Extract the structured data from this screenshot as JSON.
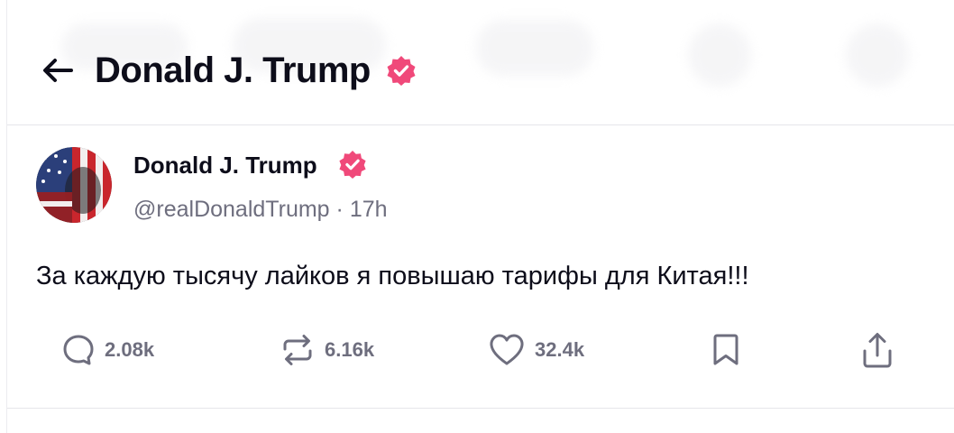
{
  "header": {
    "back_label": "back",
    "title": "Donald J. Trump",
    "verified": true
  },
  "post": {
    "author_name": "Donald J. Trump",
    "handle": "@realDonaldTrump",
    "separator": "·",
    "time": "17h",
    "text": "За каждую тысячу лайков я повышаю тарифы для Китая!!!",
    "actions": {
      "replies": "2.08k",
      "reposts": "6.16k",
      "likes": "32.4k"
    }
  },
  "icons": {
    "back": "arrow-left-icon",
    "verified": "verified-badge-icon",
    "reply": "comment-icon",
    "repost": "repost-icon",
    "like": "heart-icon",
    "bookmark": "bookmark-icon",
    "share": "share-icon"
  },
  "colors": {
    "verified_badge": "#f0497a",
    "text_primary": "#0d0d1a",
    "text_secondary": "#6e6e7e",
    "divider": "#e6e6ea"
  }
}
